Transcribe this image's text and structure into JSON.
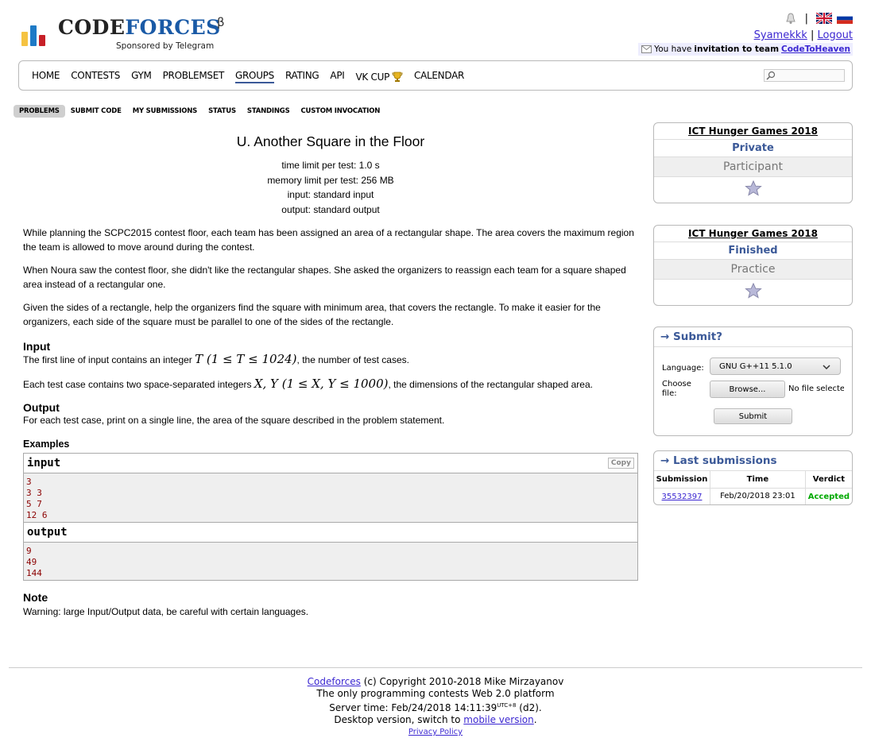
{
  "header": {
    "logo_word1": "CODE",
    "logo_word2": "FORCES",
    "logo_beta": "β",
    "sponsor": "Sponsored by Telegram",
    "separator": "|",
    "username": "Syamekkk",
    "logout": "Logout",
    "invite_prefix": "You have",
    "invite_bold": "invitation to team",
    "invite_team": "CodeToHeaven"
  },
  "menu": {
    "items": [
      "HOME",
      "CONTESTS",
      "GYM",
      "PROBLEMSET",
      "GROUPS",
      "RATING",
      "API",
      "VK CUP",
      "CALENDAR"
    ],
    "active": "GROUPS"
  },
  "submenu": {
    "items": [
      "PROBLEMS",
      "SUBMIT CODE",
      "MY SUBMISSIONS",
      "STATUS",
      "STANDINGS",
      "CUSTOM INVOCATION"
    ],
    "active": "PROBLEMS"
  },
  "problem": {
    "title": "U. Another Square in the Floor",
    "time_limit": "time limit per test: 1.0 s",
    "memory_limit": "memory limit per test: 256 MB",
    "input_file": "input: standard input",
    "output_file": "output: standard output",
    "p1": "While planning the SCPC2015 contest floor, each team has been assigned an area of a rectangular shape. The area covers the maximum region the team is allowed to move around during the contest.",
    "p2": "When Noura saw the contest floor, she didn't like the rectangular shapes. She asked the organizers to reassign each team for a square shaped area instead of a rectangular one.",
    "p3": "Given the sides of a rectangle, help the organizers find the square with minimum area, that covers the rectangle. To make it easier for the organizers, each side of the square must be parallel to one of the sides of the rectangle.",
    "input_heading": "Input",
    "input_text_1a": "The first line of input contains an integer ",
    "input_math_1": "T (1 ≤ T ≤ 1024)",
    "input_text_1b": ", the number of test cases.",
    "input_text_2a": "Each test case contains two space-separated integers ",
    "input_math_2": "X, Y (1 ≤ X, Y ≤ 1000)",
    "input_text_2b": ", the dimensions of the rectangular shaped area.",
    "output_heading": "Output",
    "output_text": "For each test case, print on a single line, the area of the square described in the problem statement.",
    "examples_heading": "Examples",
    "sample_input_label": "input",
    "sample_output_label": "output",
    "copy_label": "Copy",
    "sample_input": "3\n3 3\n5 7\n12 6",
    "sample_output": "9\n49\n144",
    "note_heading": "Note",
    "note_text": "Warning: large Input/Output data, be careful with certain languages."
  },
  "sidebar": {
    "contests": [
      {
        "name": "ICT Hunger Games 2018",
        "state": "Private",
        "role": "Participant"
      },
      {
        "name": "ICT Hunger Games 2018",
        "state": "Finished",
        "role": "Practice"
      }
    ],
    "submit": {
      "caption": "→ Submit?",
      "language_label": "Language:",
      "language_value": "GNU G++11 5.1.0",
      "file_label": "Choose file:",
      "browse_label": "Browse...",
      "no_file": "No file selected.",
      "submit_label": "Submit"
    },
    "last": {
      "caption": "→ Last submissions",
      "headers": [
        "Submission",
        "Time",
        "Verdict"
      ],
      "rows": [
        {
          "id": "35532397",
          "time": "Feb/20/2018 23:01",
          "verdict": "Accepted"
        }
      ]
    }
  },
  "footer": {
    "site": "Codeforces",
    "copyright": " (c) Copyright 2010-2018 Mike Mirzayanov",
    "line2": "The only programming contests Web 2.0 platform",
    "server_prefix": "Server time: Feb/24/2018 14:11:39",
    "utc": "UTC+8",
    "server_suffix": " (d2).",
    "desktop_prefix": "Desktop version, switch to ",
    "mobile_link": "mobile version",
    "desktop_suffix": ".",
    "privacy": "Privacy Policy"
  },
  "colors": {
    "link": "#3b27d1",
    "accent": "#3b5998",
    "accepted": "#00a900",
    "sample_text": "#8b0000"
  }
}
